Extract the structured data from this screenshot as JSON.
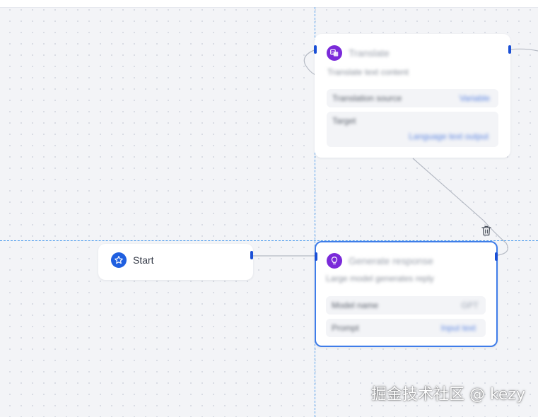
{
  "canvas": {
    "background": "#f3f4f7",
    "guide_color": "#5aa3ee",
    "edge_color": "#b5bac4",
    "selection_color": "#3f7de9"
  },
  "nodes": {
    "start": {
      "title": "Start",
      "icon": "star-icon",
      "icon_color": "#1f5fe0"
    },
    "tool": {
      "title": "Translate",
      "icon": "translate-icon",
      "icon_color": "#7a2ad9",
      "description": "Translate text content",
      "fields": [
        {
          "label": "Translation source",
          "value": "Variable"
        },
        {
          "label": "Target",
          "value": "Language text output"
        }
      ]
    },
    "llm": {
      "title": "Generate response",
      "icon": "bulb-icon",
      "icon_color": "#7a2ad9",
      "description": "Large model generates reply",
      "fields": [
        {
          "label": "Model name",
          "value": "GPT"
        },
        {
          "label": "Prompt",
          "value": "Input text"
        }
      ]
    }
  },
  "toolbar": {
    "delete_icon": "trash-icon"
  },
  "watermark": "掘金技术社区 @ kezy"
}
